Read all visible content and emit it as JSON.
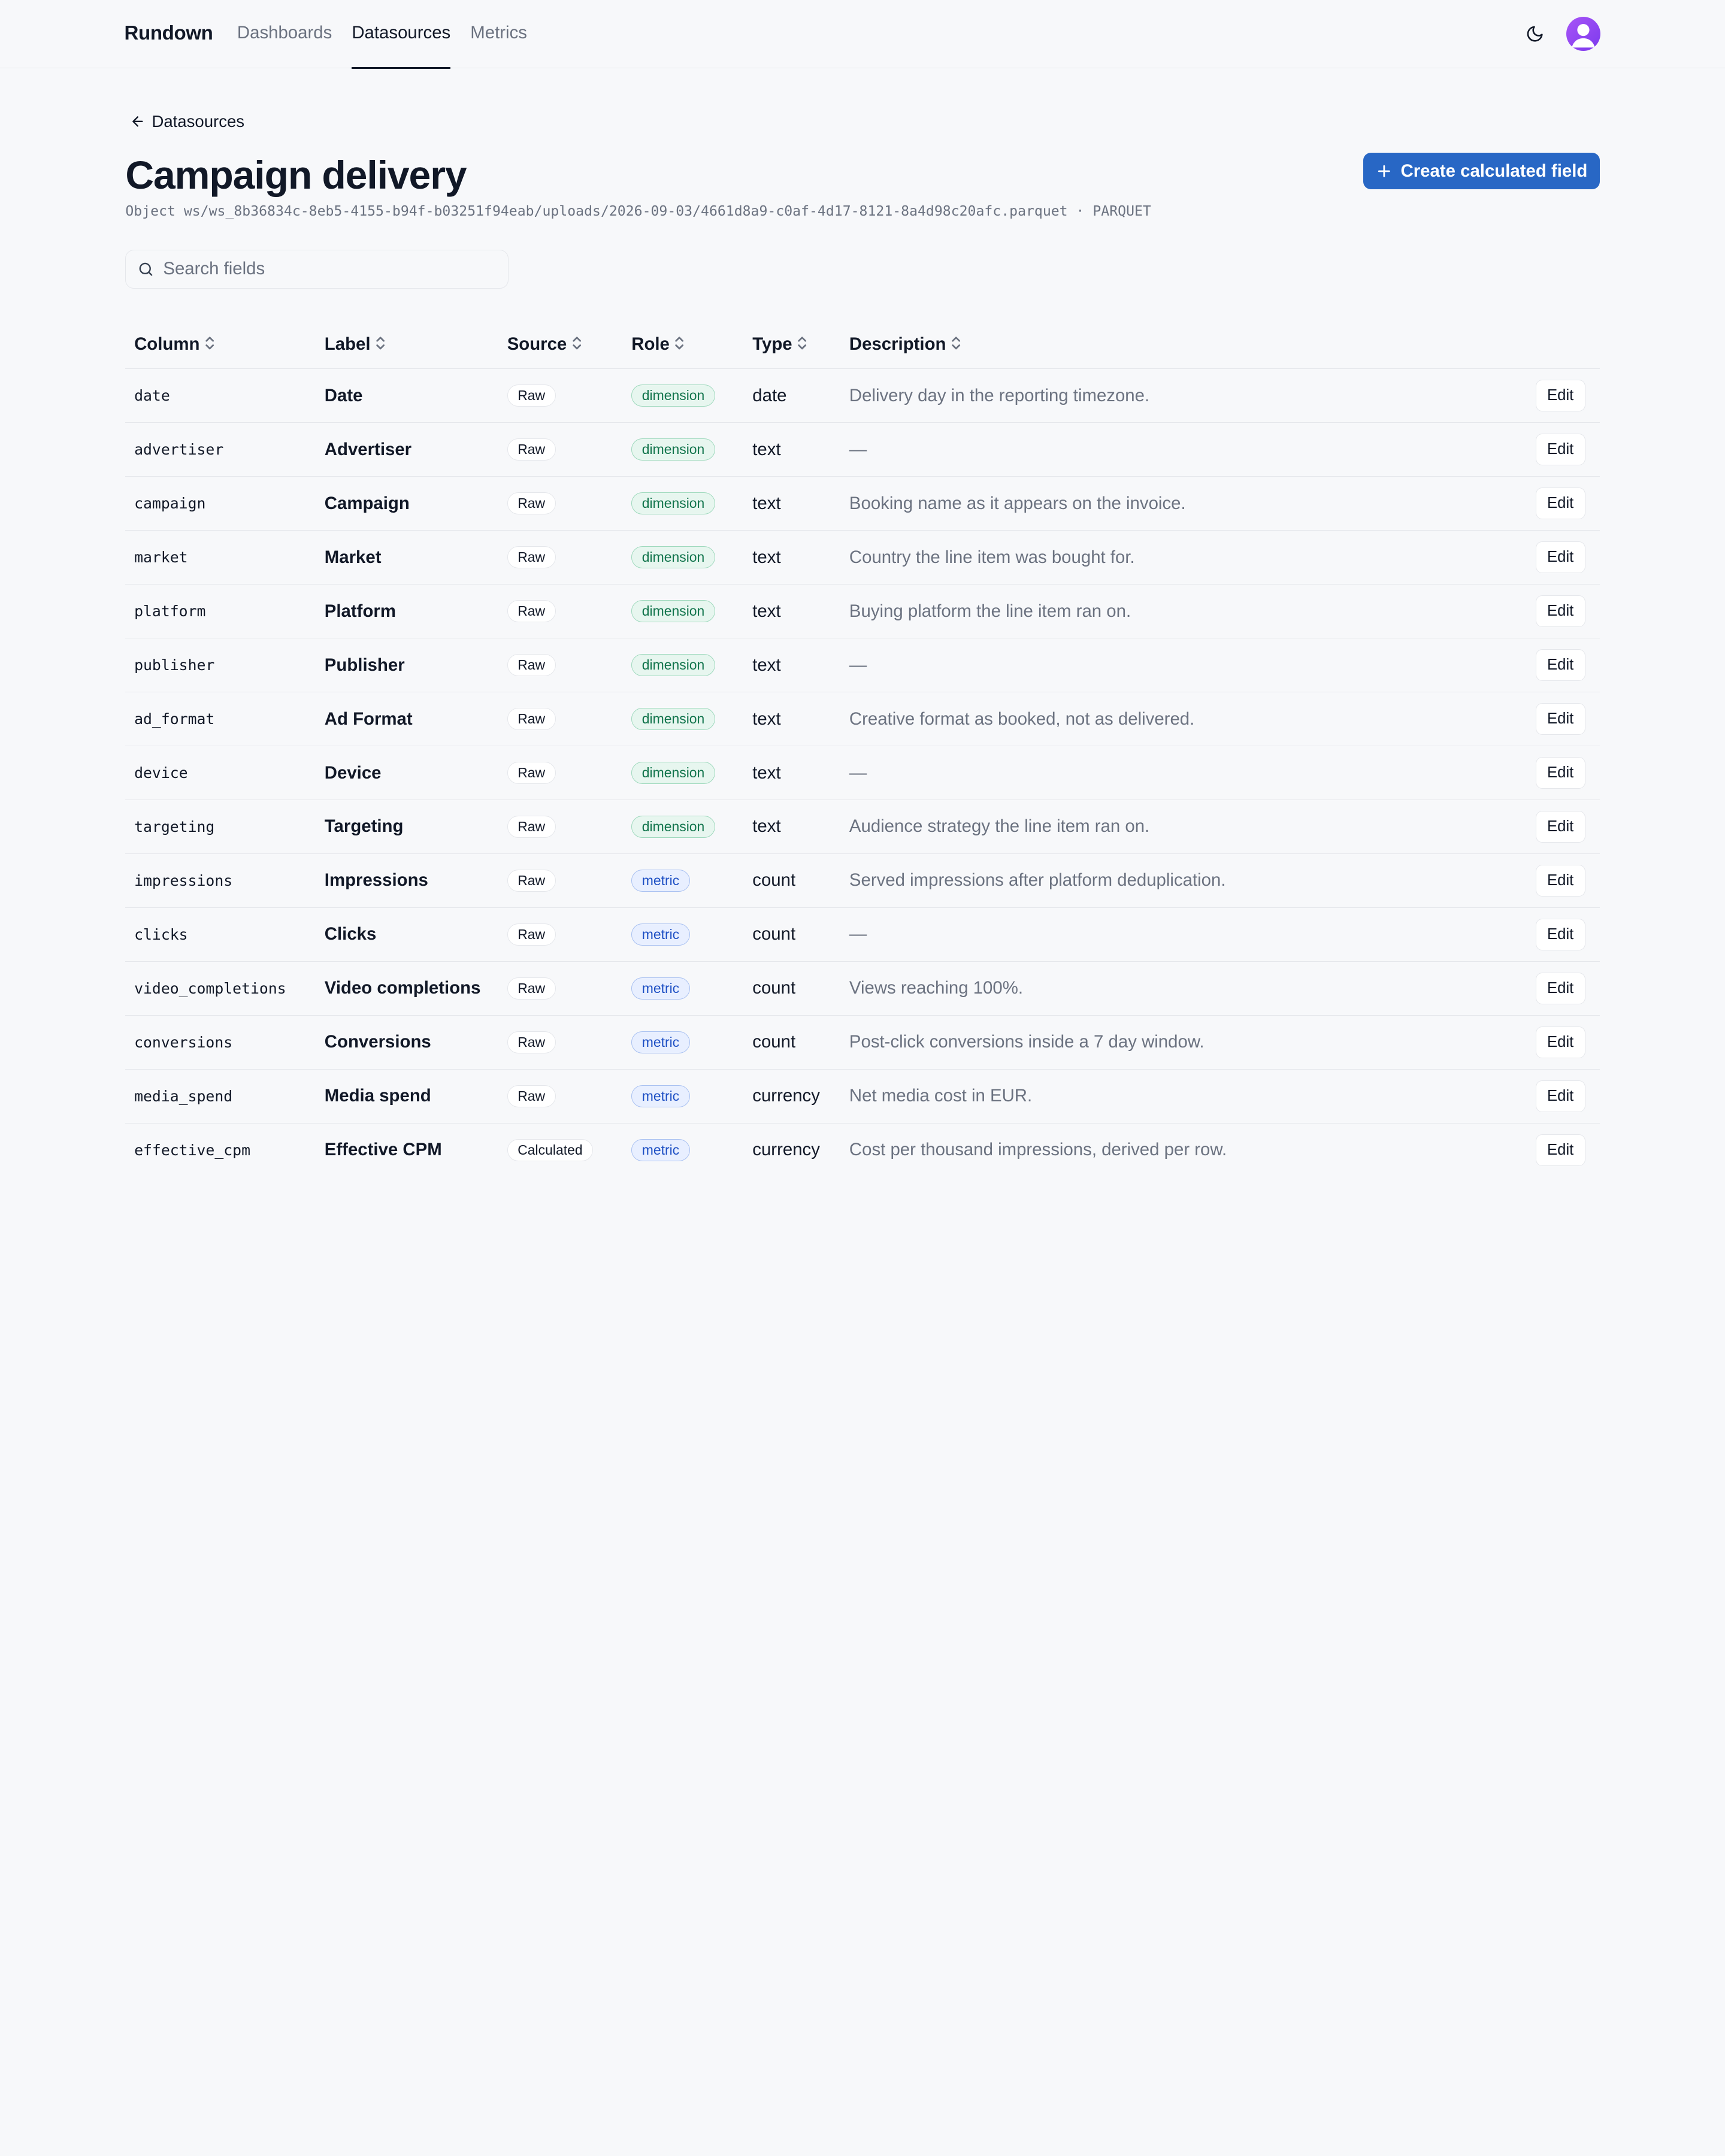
{
  "nav": {
    "brand": "Rundown",
    "links": [
      {
        "label": "Dashboards",
        "active": false
      },
      {
        "label": "Datasources",
        "active": true
      },
      {
        "label": "Metrics",
        "active": false
      }
    ],
    "theme_icon": "moon-icon",
    "avatar_icon": "user-avatar-icon"
  },
  "header": {
    "back_label": "Datasources",
    "title": "Campaign delivery",
    "object_path": "Object ws/ws_8b36834c-8eb5-4155-b94f-b03251f94eab/uploads/2026-09-03/4661d8a9-c0af-4d17-8121-8a4d98c20afc.parquet · PARQUET",
    "create_button_label": "Create calculated field"
  },
  "search": {
    "placeholder": "Search fields",
    "value": ""
  },
  "table": {
    "headers": [
      "Column",
      "Label",
      "Source",
      "Role",
      "Type",
      "Description"
    ],
    "edit_label": "Edit",
    "rows": [
      {
        "column": "date",
        "label": "Date",
        "source": "Raw",
        "role": "dimension",
        "type": "date",
        "description": "Delivery day in the reporting timezone."
      },
      {
        "column": "advertiser",
        "label": "Advertiser",
        "source": "Raw",
        "role": "dimension",
        "type": "text",
        "description": "—"
      },
      {
        "column": "campaign",
        "label": "Campaign",
        "source": "Raw",
        "role": "dimension",
        "type": "text",
        "description": "Booking name as it appears on the invoice."
      },
      {
        "column": "market",
        "label": "Market",
        "source": "Raw",
        "role": "dimension",
        "type": "text",
        "description": "Country the line item was bought for."
      },
      {
        "column": "platform",
        "label": "Platform",
        "source": "Raw",
        "role": "dimension",
        "type": "text",
        "description": "Buying platform the line item ran on."
      },
      {
        "column": "publisher",
        "label": "Publisher",
        "source": "Raw",
        "role": "dimension",
        "type": "text",
        "description": "—"
      },
      {
        "column": "ad_format",
        "label": "Ad Format",
        "source": "Raw",
        "role": "dimension",
        "type": "text",
        "description": "Creative format as booked, not as delivered."
      },
      {
        "column": "device",
        "label": "Device",
        "source": "Raw",
        "role": "dimension",
        "type": "text",
        "description": "—"
      },
      {
        "column": "targeting",
        "label": "Targeting",
        "source": "Raw",
        "role": "dimension",
        "type": "text",
        "description": "Audience strategy the line item ran on."
      },
      {
        "column": "impressions",
        "label": "Impressions",
        "source": "Raw",
        "role": "metric",
        "type": "count",
        "description": "Served impressions after platform deduplication."
      },
      {
        "column": "clicks",
        "label": "Clicks",
        "source": "Raw",
        "role": "metric",
        "type": "count",
        "description": "—"
      },
      {
        "column": "video_completions",
        "label": "Video completions",
        "source": "Raw",
        "role": "metric",
        "type": "count",
        "description": "Views reaching 100%."
      },
      {
        "column": "conversions",
        "label": "Conversions",
        "source": "Raw",
        "role": "metric",
        "type": "count",
        "description": "Post-click conversions inside a 7 day window."
      },
      {
        "column": "media_spend",
        "label": "Media spend",
        "source": "Raw",
        "role": "metric",
        "type": "currency",
        "description": "Net media cost in EUR."
      },
      {
        "column": "effective_cpm",
        "label": "Effective CPM",
        "source": "Calculated",
        "role": "metric",
        "type": "currency",
        "description": "Cost per thousand impressions, derived per row."
      }
    ]
  },
  "colors": {
    "primary": "#2867c5",
    "dimension": "#11744c",
    "metric": "#1d4fc4"
  }
}
